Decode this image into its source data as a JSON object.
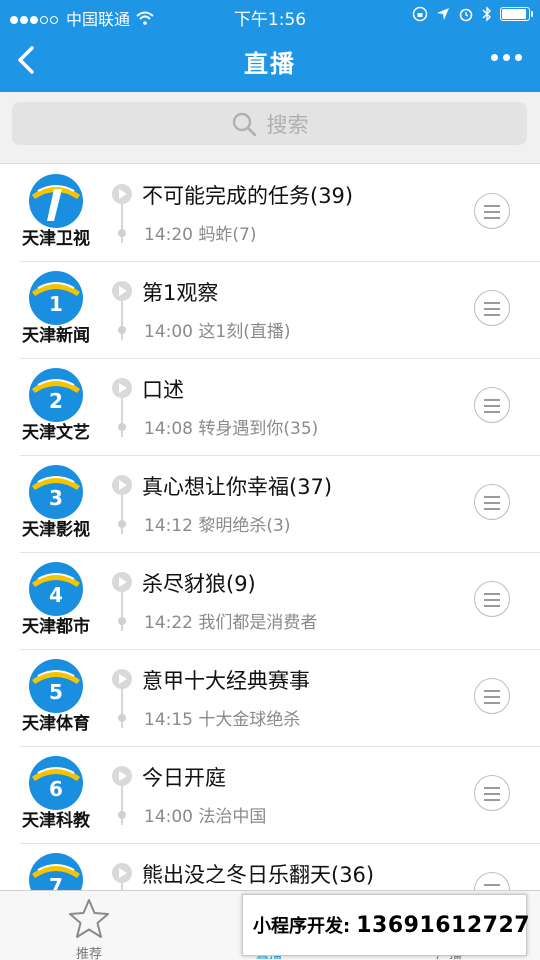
{
  "status_bar": {
    "carrier": "中国联通",
    "time": "下午1:56",
    "battery_level": 0.85
  },
  "nav": {
    "title": "直播"
  },
  "search": {
    "placeholder": "搜索"
  },
  "channels": [
    {
      "name": "天津卫视",
      "logo_number": "",
      "current": "不可能完成的任务(39)",
      "next": "14:20 蚂蚱(7)"
    },
    {
      "name": "天津新闻",
      "logo_number": "1",
      "current": "第1观察",
      "next": "14:00 这1刻(直播)"
    },
    {
      "name": "天津文艺",
      "logo_number": "2",
      "current": "口述",
      "next": "14:08 转身遇到你(35)"
    },
    {
      "name": "天津影视",
      "logo_number": "3",
      "current": "真心想让你幸福(37)",
      "next": "14:12 黎明绝杀(3)"
    },
    {
      "name": "天津都市",
      "logo_number": "4",
      "current": "杀尽豺狼(9)",
      "next": "14:22 我们都是消费者"
    },
    {
      "name": "天津体育",
      "logo_number": "5",
      "current": "意甲十大经典赛事",
      "next": "14:15 十大金球绝杀"
    },
    {
      "name": "天津科教",
      "logo_number": "6",
      "current": "今日开庭",
      "next": "14:00 法治中国"
    },
    {
      "name": "",
      "logo_number": "7",
      "current": "熊出没之冬日乐翻天(36)",
      "next": ""
    }
  ],
  "tabbar": {
    "tabs": [
      {
        "label": "推荐"
      },
      {
        "label": "直播"
      },
      {
        "label": "广播"
      }
    ]
  },
  "promo": {
    "label": "小程序开发:",
    "phone": "13691612727"
  },
  "colors": {
    "accent": "#1f95e6",
    "logo_blue": "#1a8fe0",
    "logo_yellow": "#f5c400"
  }
}
